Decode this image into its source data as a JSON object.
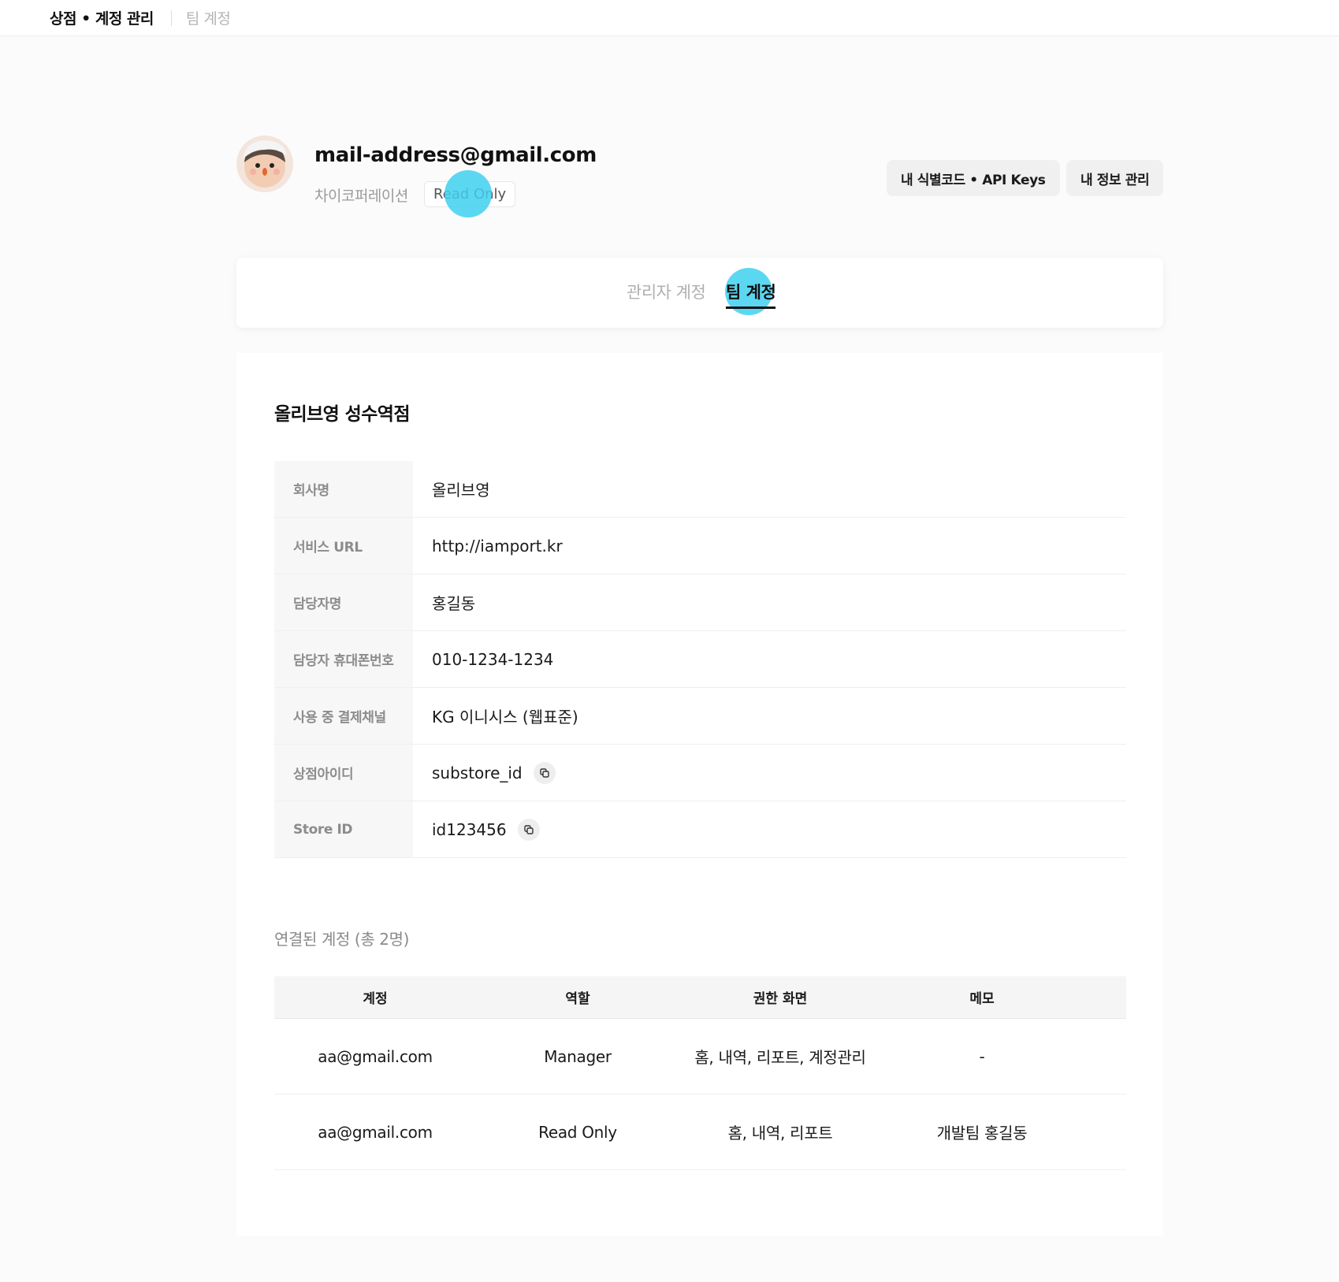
{
  "topbar": {
    "breadcrumb_main": "상점 • 계정 관리",
    "breadcrumb_current": "팀 계정"
  },
  "profile": {
    "email": "mail-address@gmail.com",
    "company": "차이코퍼레이션",
    "role_badge": "Read Only",
    "buttons": {
      "identifiers_api": "내 식별코드  •  API Keys",
      "my_info": "내 정보 관리"
    }
  },
  "tabs": {
    "admin": "관리자 계정",
    "team": "팀 계정",
    "active": "team"
  },
  "store": {
    "title": "올리브영 성수역점",
    "fields": [
      {
        "label": "회사명",
        "value": "올리브영"
      },
      {
        "label": "서비스 URL",
        "value": "http://iamport.kr"
      },
      {
        "label": "담당자명",
        "value": "홍길동"
      },
      {
        "label": "담당자 휴대폰번호",
        "value": "010-1234-1234"
      },
      {
        "label": "사용 중 결제채널",
        "value": "KG 이니시스 (웹표준)"
      },
      {
        "label": "상점아이디",
        "value": "substore_id"
      },
      {
        "label": "Store ID",
        "value": "id123456"
      }
    ]
  },
  "linked": {
    "title": "연결된 계정 (총 2명)",
    "columns": [
      "계정",
      "역할",
      "권한 화면",
      "메모"
    ],
    "rows": [
      [
        "aa@gmail.com",
        "Manager",
        "홈, 내역, 리포트, 계정관리",
        "-"
      ],
      [
        "aa@gmail.com",
        "Read Only",
        "홈, 내역, 리포트",
        "개발팀 홍길동"
      ]
    ]
  },
  "colors": {
    "highlight": "#40d0f0",
    "background": "#fbfbfb",
    "muted_text": "#9a9a9a"
  }
}
